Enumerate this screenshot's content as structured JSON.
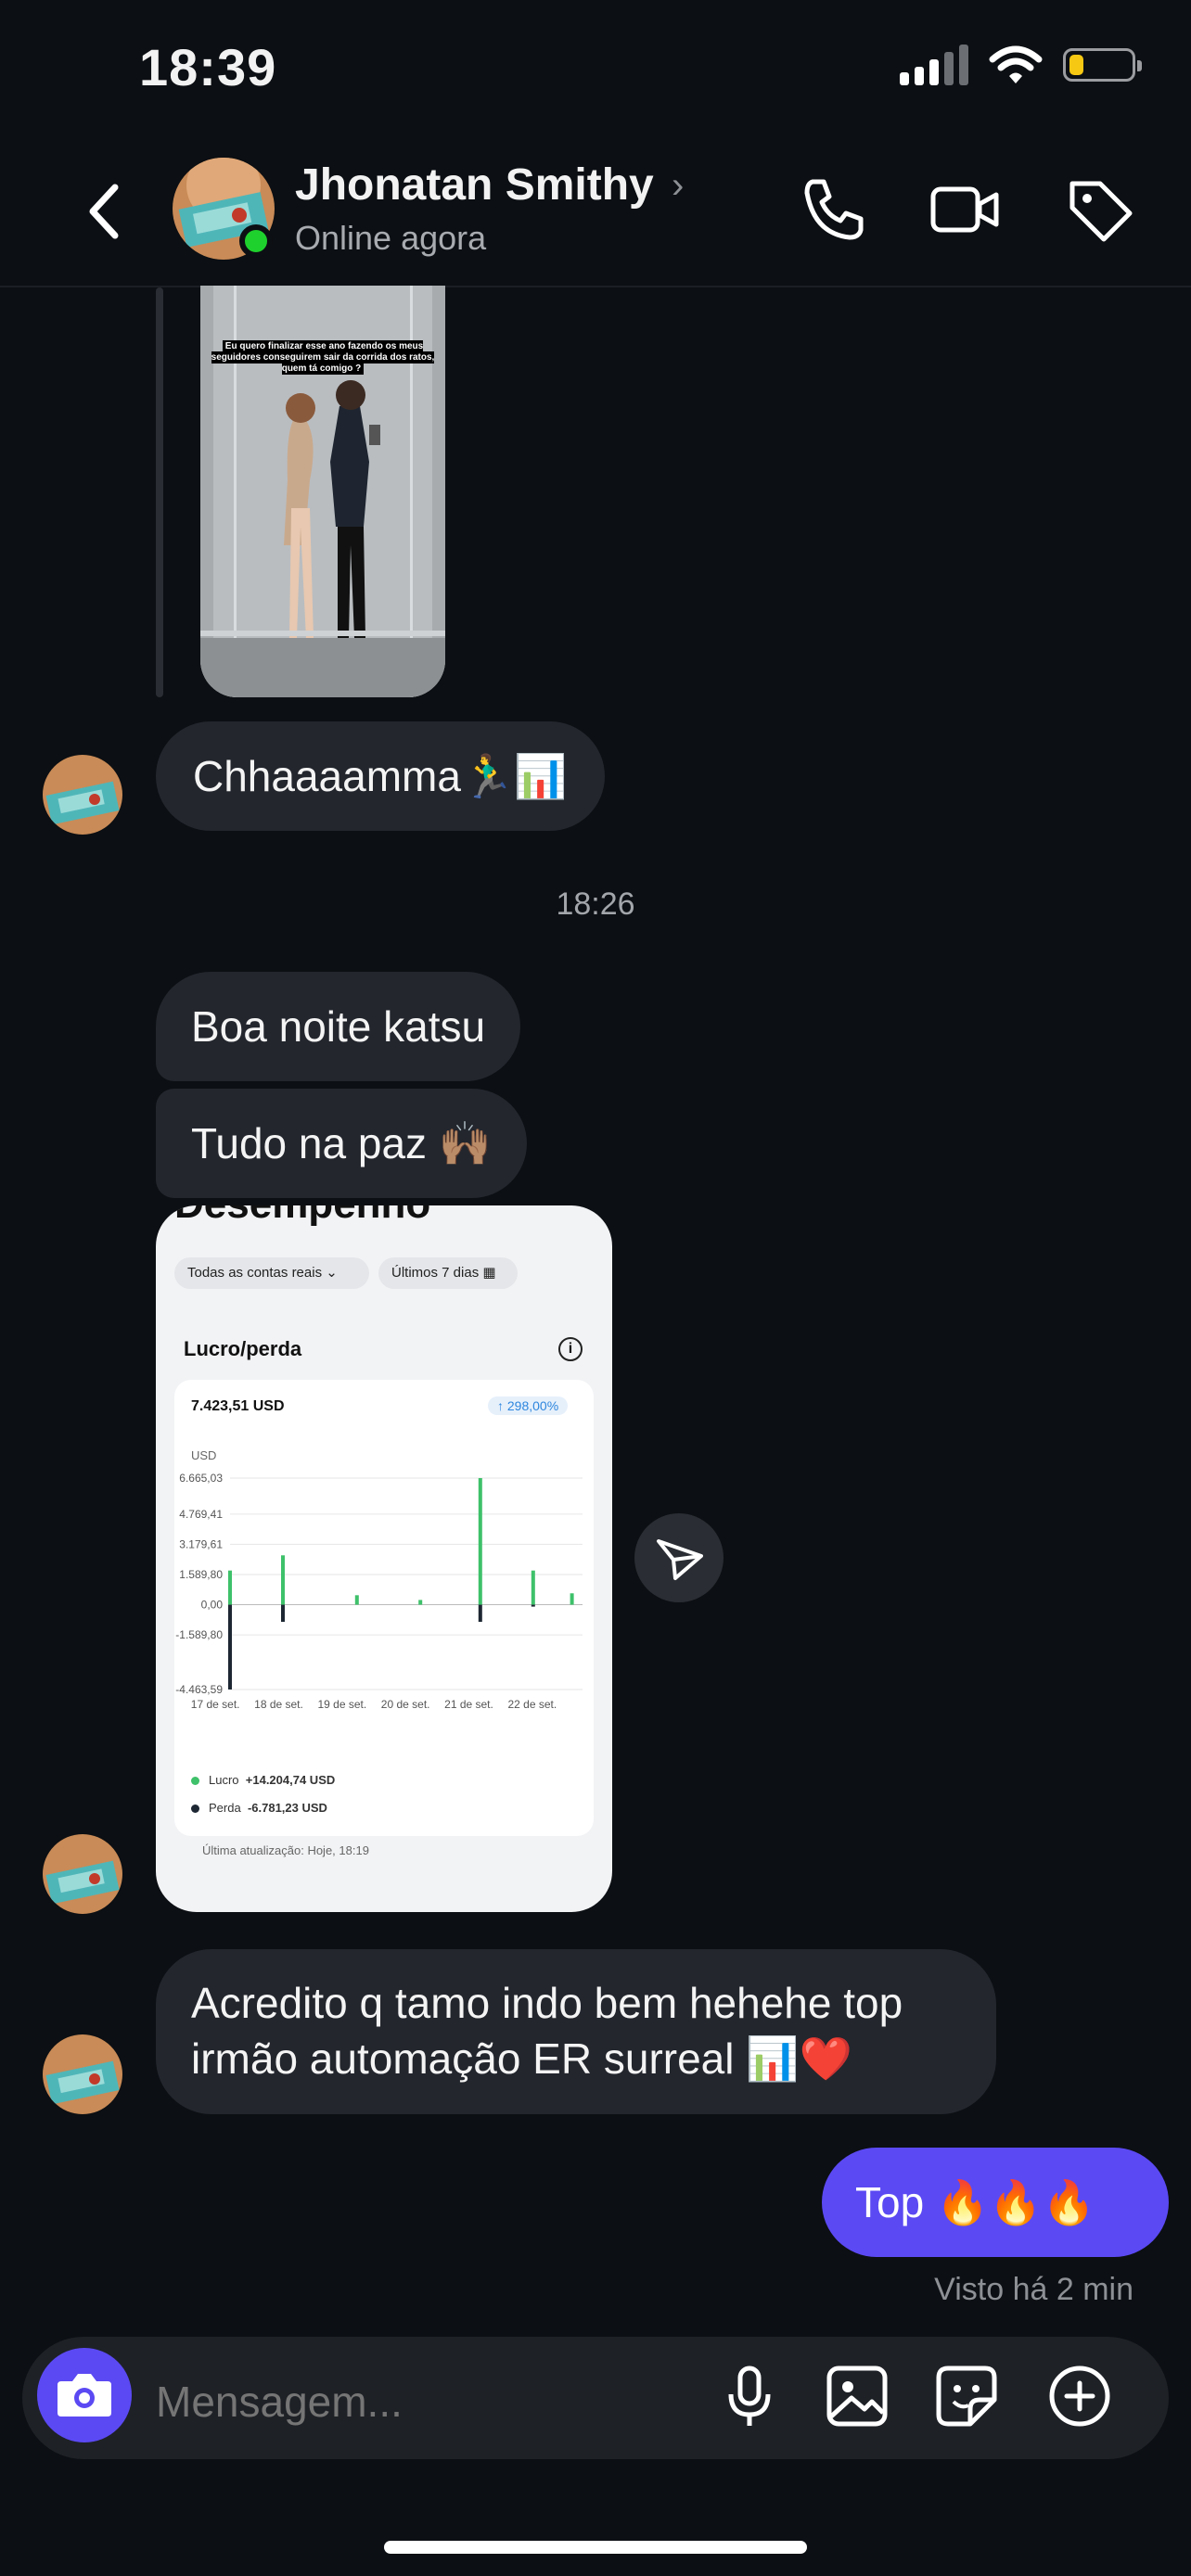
{
  "status_bar": {
    "time": "18:39",
    "battery_level": 0.22,
    "battery_color": "#f6c813"
  },
  "header": {
    "contact_name": "Jhonatan Smithy",
    "status": "Online agora",
    "icons": [
      "back-chevron-icon",
      "phone-icon",
      "video-camera-icon",
      "tag-icon"
    ]
  },
  "messages": {
    "m1": "Chhaaaamma🏃‍♂️📊",
    "timestamp": "18:26",
    "m2": "Boa noite katsu",
    "m3": "Tudo na paz 🙌🏽",
    "m4_line1": "Acredito q tamo indo bem hehehe top",
    "m4_line2": "irmão automação ER surreal 📊❤️",
    "m5": "Top 🔥🔥🔥",
    "seen": "Visto há 2 min"
  },
  "story": {
    "caption": "Eu quero finalizar esse ano fazendo os meus seguidores conseguirem sair da corrida dos ratos, quem tá comigo ?"
  },
  "performance": {
    "title": "Desempenho",
    "filter_accounts": "Todas as contas reais",
    "filter_period": "Últimos 7 dias",
    "section": "Lucro/perda",
    "total": "7.423,51 USD",
    "change": "↑ 298,00%",
    "currency": "USD",
    "legend_profit_label": "Lucro",
    "legend_profit_value": "+14.204,74 USD",
    "legend_loss_label": "Perda",
    "legend_loss_value": "-6.781,23 USD",
    "updated": "Última atualização: Hoje, 18:19"
  },
  "chart_data": {
    "type": "bar",
    "categories": [
      "17 de set.",
      "18 de set.",
      "19 de set.",
      "20 de set.",
      "21 de set.",
      "22 de set."
    ],
    "y_ticks": [
      "6.665,03",
      "4.769,41",
      "3.179,61",
      "1.589,80",
      "0,00",
      "-1.589,80",
      "-4.463,59"
    ],
    "y_tick_values": [
      6665.03,
      4769.41,
      3179.61,
      1589.8,
      0,
      -1589.8,
      -4463.59
    ],
    "bar_x_offsets": [
      0.0,
      0.15,
      0.36,
      0.54,
      0.71,
      0.86,
      0.97
    ],
    "series": [
      {
        "name": "Lucro",
        "color": "#3ec16a",
        "values": [
          1800,
          2600,
          500,
          250,
          6665,
          1800,
          600
        ]
      },
      {
        "name": "Perda",
        "color": "#1d2733",
        "values": [
          -4463,
          -900,
          0,
          0,
          -900,
          -100,
          0
        ]
      }
    ],
    "ylim": [
      -4463.59,
      6665.03
    ]
  },
  "composer": {
    "placeholder": "Mensagem..."
  },
  "colors": {
    "accent": "#5b49f3",
    "online": "#1fd12d",
    "background": "#0c0f13"
  }
}
